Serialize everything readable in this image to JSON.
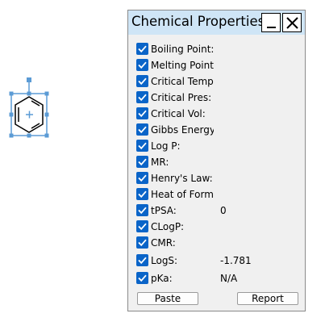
{
  "panel": {
    "title": "Chemical Properties",
    "properties": [
      {
        "label": "Boiling Point:",
        "value": "",
        "checked": true
      },
      {
        "label": "Melting Point:",
        "value": "",
        "checked": true
      },
      {
        "label": "Critical Temp",
        "value": "",
        "checked": true
      },
      {
        "label": "Critical Pres:",
        "value": "",
        "checked": true
      },
      {
        "label": "Critical Vol:",
        "value": "",
        "checked": true
      },
      {
        "label": "Gibbs Energy:",
        "value": "",
        "checked": true
      },
      {
        "label": "Log P:",
        "value": "",
        "checked": true
      },
      {
        "label": "MR:",
        "value": "",
        "checked": true
      },
      {
        "label": "Henry's Law:",
        "value": "",
        "checked": true
      },
      {
        "label": "Heat of Form",
        "value": "",
        "checked": true
      },
      {
        "label": "tPSA:",
        "value": "0",
        "checked": true
      },
      {
        "label": "CLogP:",
        "value": "",
        "checked": true
      },
      {
        "label": "CMR:",
        "value": "",
        "checked": true
      },
      {
        "label": "LogS:",
        "value": "-1.781",
        "checked": true
      },
      {
        "label": "pKa:",
        "value": "N/A",
        "checked": true
      }
    ],
    "buttons": {
      "paste": "Paste",
      "report": "Report"
    }
  },
  "colors": {
    "titlebar": "#cfe5f6",
    "checkbox": "#0a64c8",
    "selection": "#5b9bd5",
    "molecule": "#000000"
  }
}
